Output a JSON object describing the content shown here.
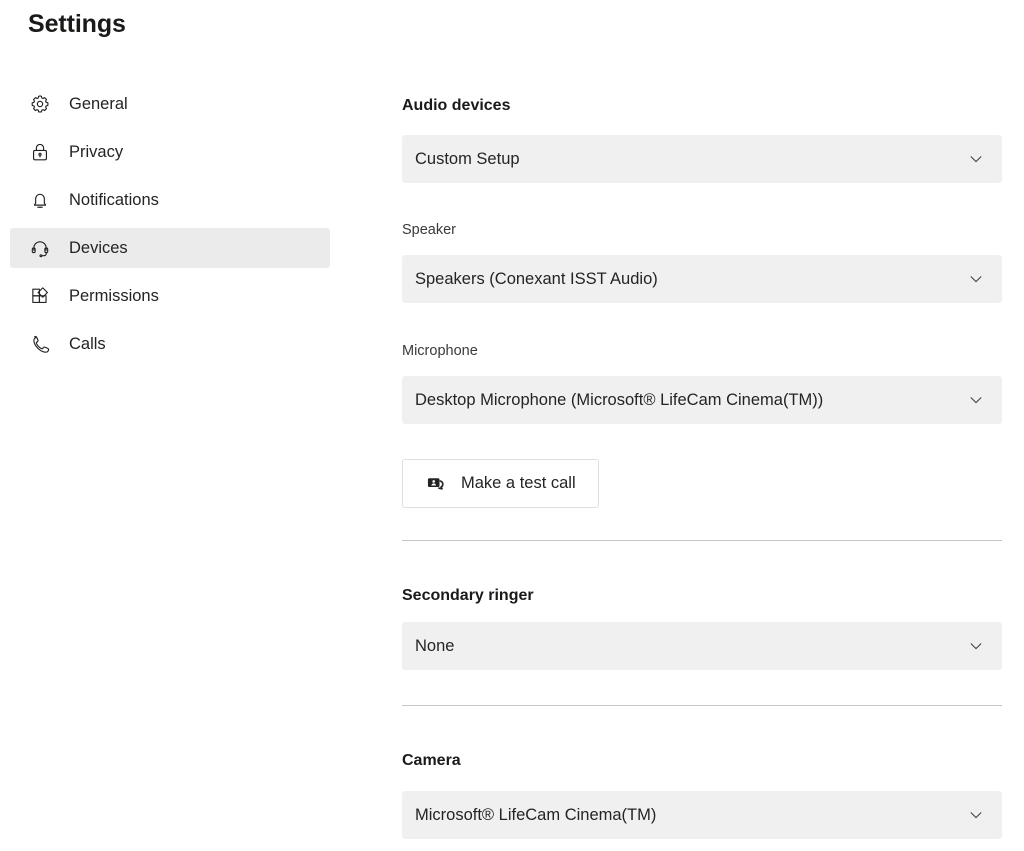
{
  "page": {
    "title": "Settings"
  },
  "sidebar": {
    "items": [
      {
        "label": "General",
        "icon": "gear-icon",
        "selected": false
      },
      {
        "label": "Privacy",
        "icon": "lock-icon",
        "selected": false
      },
      {
        "label": "Notifications",
        "icon": "bell-icon",
        "selected": false
      },
      {
        "label": "Devices",
        "icon": "headset-icon",
        "selected": true
      },
      {
        "label": "Permissions",
        "icon": "app-grid-icon",
        "selected": false
      },
      {
        "label": "Calls",
        "icon": "phone-icon",
        "selected": false
      }
    ]
  },
  "main": {
    "audio_devices": {
      "heading": "Audio devices",
      "setup": {
        "value": "Custom Setup"
      },
      "speaker": {
        "label": "Speaker",
        "value": "Speakers (Conexant ISST Audio)"
      },
      "microphone": {
        "label": "Microphone",
        "value": "Desktop Microphone (Microsoft® LifeCam Cinema(TM))"
      },
      "test_call_button": {
        "label": "Make a test call",
        "icon": "video-call-icon"
      }
    },
    "secondary_ringer": {
      "heading": "Secondary ringer",
      "value": "None"
    },
    "camera": {
      "heading": "Camera",
      "value": "Microsoft® LifeCam Cinema(TM)"
    }
  },
  "colors": {
    "selected_nav_bg": "#ebebeb",
    "dropdown_bg": "#f0f0f0",
    "divider": "#c8c6c4",
    "text": "#252423",
    "page_bg": "#ffffff"
  },
  "icons": {
    "chevron": "chevron-down-icon"
  }
}
